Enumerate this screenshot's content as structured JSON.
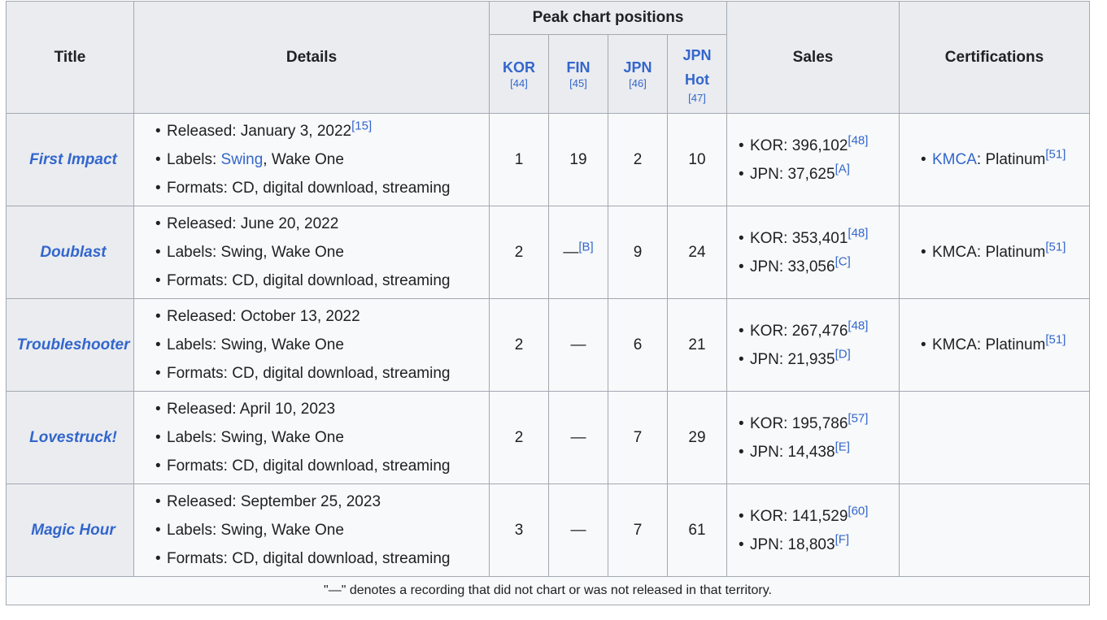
{
  "header": {
    "title": "Title",
    "details": "Details",
    "peak": "Peak chart positions",
    "sales": "Sales",
    "certifications": "Certifications",
    "charts": [
      {
        "name": "KOR",
        "ref": "[44]"
      },
      {
        "name": "FIN",
        "ref": "[45]"
      },
      {
        "name": "JPN",
        "ref": "[46]"
      },
      {
        "name": "JPN Hot",
        "ref": "[47]"
      }
    ]
  },
  "rows": [
    {
      "title": "First Impact",
      "released": "Released: January 3, 2022",
      "released_ref": "[15]",
      "labels_prefix": "Labels: ",
      "labels_link": "Swing",
      "labels_rest": ", Wake One",
      "formats": "Formats: CD, digital download, streaming",
      "kor": "1",
      "fin": "19",
      "fin_ref": "",
      "jpn": "2",
      "jpnhot": "10",
      "sales_kor": "KOR: 396,102",
      "sales_kor_ref": "[48]",
      "sales_jpn": "JPN: 37,625",
      "sales_jpn_ref": "[A]",
      "cert_link": "KMCA",
      "cert_text": ": Platinum",
      "cert_ref": "[51]"
    },
    {
      "title": "Doublast",
      "released": "Released: June 20, 2022",
      "released_ref": "",
      "labels_prefix": "Labels: Swing, Wake One",
      "labels_link": "",
      "labels_rest": "",
      "formats": "Formats: CD, digital download, streaming",
      "kor": "2",
      "fin": "—",
      "fin_ref": "[B]",
      "jpn": "9",
      "jpnhot": "24",
      "sales_kor": "KOR: 353,401",
      "sales_kor_ref": "[48]",
      "sales_jpn": "JPN: 33,056",
      "sales_jpn_ref": "[C]",
      "cert_link": "",
      "cert_text": "KMCA: Platinum",
      "cert_ref": "[51]"
    },
    {
      "title": "Troubleshooter",
      "released": "Released: October 13, 2022",
      "released_ref": "",
      "labels_prefix": "Labels: Swing, Wake One",
      "labels_link": "",
      "labels_rest": "",
      "formats": "Formats: CD, digital download, streaming",
      "kor": "2",
      "fin": "—",
      "fin_ref": "",
      "jpn": "6",
      "jpnhot": "21",
      "sales_kor": "KOR: 267,476",
      "sales_kor_ref": "[48]",
      "sales_jpn": "JPN: 21,935",
      "sales_jpn_ref": "[D]",
      "cert_link": "",
      "cert_text": "KMCA: Platinum",
      "cert_ref": "[51]"
    },
    {
      "title": "Lovestruck!",
      "released": "Released: April 10, 2023",
      "released_ref": "",
      "labels_prefix": "Labels: Swing, Wake One",
      "labels_link": "",
      "labels_rest": "",
      "formats": "Formats: CD, digital download, streaming",
      "kor": "2",
      "fin": "—",
      "fin_ref": "",
      "jpn": "7",
      "jpnhot": "29",
      "sales_kor": "KOR: 195,786",
      "sales_kor_ref": "[57]",
      "sales_jpn": "JPN: 14,438",
      "sales_jpn_ref": "[E]",
      "cert_link": "",
      "cert_text": "",
      "cert_ref": ""
    },
    {
      "title": "Magic Hour",
      "released": "Released: September 25, 2023",
      "released_ref": "",
      "labels_prefix": "Labels: Swing, Wake One",
      "labels_link": "",
      "labels_rest": "",
      "formats": "Formats: CD, digital download, streaming",
      "kor": "3",
      "fin": "—",
      "fin_ref": "",
      "jpn": "7",
      "jpnhot": "61",
      "sales_kor": "KOR: 141,529",
      "sales_kor_ref": "[60]",
      "sales_jpn": "JPN: 18,803",
      "sales_jpn_ref": "[F]",
      "cert_link": "",
      "cert_text": "",
      "cert_ref": ""
    }
  ],
  "footnote": "\"—\" denotes a recording that did not chart or was not released in that territory."
}
